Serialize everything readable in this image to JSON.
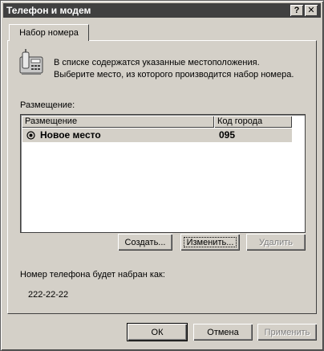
{
  "window": {
    "title": "Телефон и модем",
    "help_button": "?",
    "close_button": "✕"
  },
  "tabs": [
    {
      "label": "Набор номера",
      "active": true
    }
  ],
  "description": {
    "line1": "В списке содержатся указанные местоположения.",
    "line2": "Выберите место, из которого производится набор номера."
  },
  "locations": {
    "label": "Размещение:",
    "columns": [
      "Размещение",
      "Код города"
    ],
    "rows": [
      {
        "name": "Новое место",
        "area_code": "095",
        "selected": true
      }
    ]
  },
  "list_buttons": {
    "create": "Создать...",
    "edit": "Изменить...",
    "delete": "Удалить"
  },
  "dial": {
    "label": "Номер телефона будет набран как:",
    "number": "222-22-22"
  },
  "dialog_buttons": {
    "ok": "ОК",
    "cancel": "Отмена",
    "apply": "Применить"
  },
  "colors": {
    "face": "#d4d0c8",
    "titlebar": "#404040",
    "selection": "#d4d0c8"
  },
  "icons": [
    "telephone-icon",
    "radio-selected-icon"
  ]
}
